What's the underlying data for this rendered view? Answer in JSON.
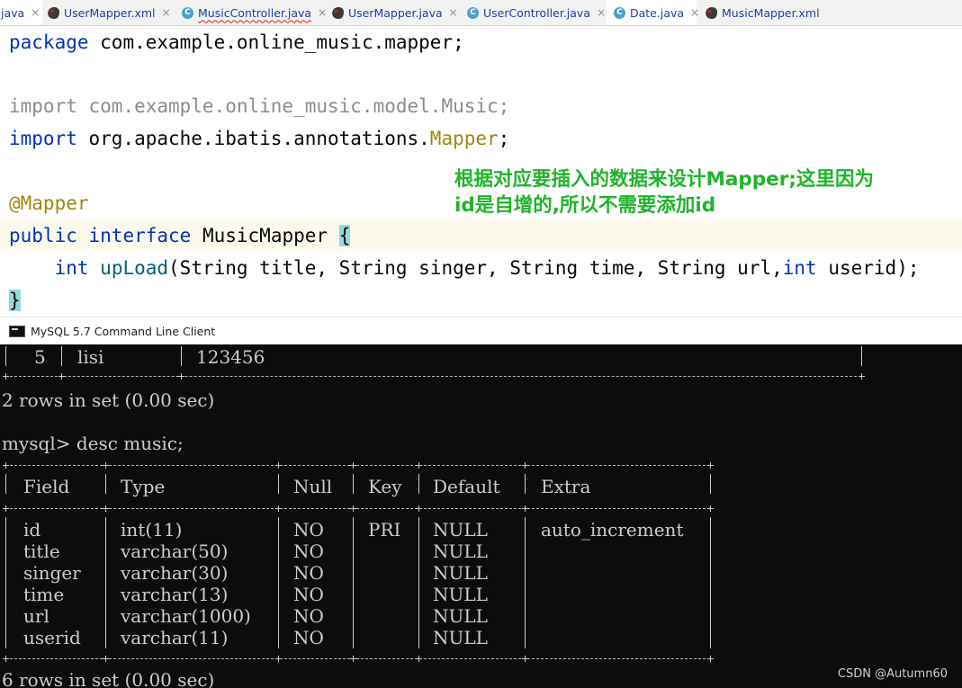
{
  "tabs": [
    {
      "label": "java",
      "icon": "none",
      "active": true
    },
    {
      "label": "UserMapper.xml",
      "icon": "mybatis-icon"
    },
    {
      "label": "MusicController.java",
      "icon": "class-icon",
      "error_underline": true
    },
    {
      "label": "UserMapper.java",
      "icon": "mybatis-icon"
    },
    {
      "label": "UserController.java",
      "icon": "class-icon"
    },
    {
      "label": "Date.java",
      "icon": "class-icon",
      "active": true
    },
    {
      "label": "MusicMapper.xml",
      "icon": "mybatis-icon"
    }
  ],
  "tab_close_glyph": "×",
  "tab_class_glyph": "C",
  "code": {
    "line1": {
      "kw": "package",
      "rest": " com.example.online_music.mapper;"
    },
    "line2": {
      "kw": "import",
      "rest": " com.example.online_music.model.Music;"
    },
    "line3": {
      "kw": "import",
      "mid": " org.apache.ibatis.annotations.",
      "cls": "Mapper",
      "end": ";"
    },
    "line4": {
      "anno": "@Mapper"
    },
    "line5": {
      "kw1": "public",
      "kw2": "interface",
      "name": " MusicMapper ",
      "brace": "{"
    },
    "line6": {
      "indent": "    ",
      "kw": "int",
      "method": "upLoad",
      "args_a": "(String title, String singer, String time, String url,",
      "kw2": "int",
      "args_b": " userid);"
    },
    "line7": {
      "brace": "}"
    }
  },
  "callout": {
    "line1": "根据对应要插入的数据来设计Mapper;这里因为",
    "line2": "id是自增的,所以不需要添加id"
  },
  "mysql_window": {
    "title": "MySQL 5.7 Command Line Client",
    "prev_row": {
      "id": "5",
      "name": "lisi",
      "pwd": "123456"
    },
    "rows_msg_1": "2 rows in set (0.00 sec)",
    "prompt": "mysql> desc music;",
    "headers": [
      "Field",
      "Type",
      "Null",
      "Key",
      "Default",
      "Extra"
    ],
    "rows": [
      {
        "field": "id",
        "type": "int(11)",
        "null": "NO",
        "key": "PRI",
        "default": "NULL",
        "extra": "auto_increment"
      },
      {
        "field": "title",
        "type": "varchar(50)",
        "null": "NO",
        "key": "",
        "default": "NULL",
        "extra": ""
      },
      {
        "field": "singer",
        "type": "varchar(30)",
        "null": "NO",
        "key": "",
        "default": "NULL",
        "extra": ""
      },
      {
        "field": "time",
        "type": "varchar(13)",
        "null": "NO",
        "key": "",
        "default": "NULL",
        "extra": ""
      },
      {
        "field": "url",
        "type": "varchar(1000)",
        "null": "NO",
        "key": "",
        "default": "NULL",
        "extra": ""
      },
      {
        "field": "userid",
        "type": "varchar(11)",
        "null": "NO",
        "key": "",
        "default": "NULL",
        "extra": ""
      }
    ],
    "rows_msg_2": "6 rows in set (0.00 sec)"
  },
  "watermark": "CSDN @Autumn60"
}
